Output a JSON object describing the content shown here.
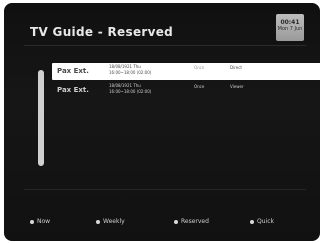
{
  "header": {
    "title": "TV Guide - Reserved",
    "clock_time": "00:41",
    "clock_date": "Mon 7 Jun"
  },
  "reservations": [
    {
      "channel": "Pax Ext.",
      "when_line1": "18/08/1921 Thu",
      "when_line2": "16:00~18:00 (02:00)",
      "mode": "Once",
      "status": "Direct",
      "selected": true
    },
    {
      "channel": "Pax Ext.",
      "when_line1": "18/08/1921 Thu",
      "when_line2": "16:00~18:00 (02:00)",
      "mode": "Once",
      "status": "Viewer",
      "selected": false
    }
  ],
  "scrollbar": {
    "position": 0
  },
  "footer": {
    "keys": [
      {
        "label": "Now",
        "icon": "red-dot-icon"
      },
      {
        "label": "Weekly",
        "icon": "green-dot-icon"
      },
      {
        "label": "Reserved",
        "icon": "yellow-dot-icon"
      },
      {
        "label": "Quick",
        "icon": "blue-dot-icon"
      }
    ]
  }
}
